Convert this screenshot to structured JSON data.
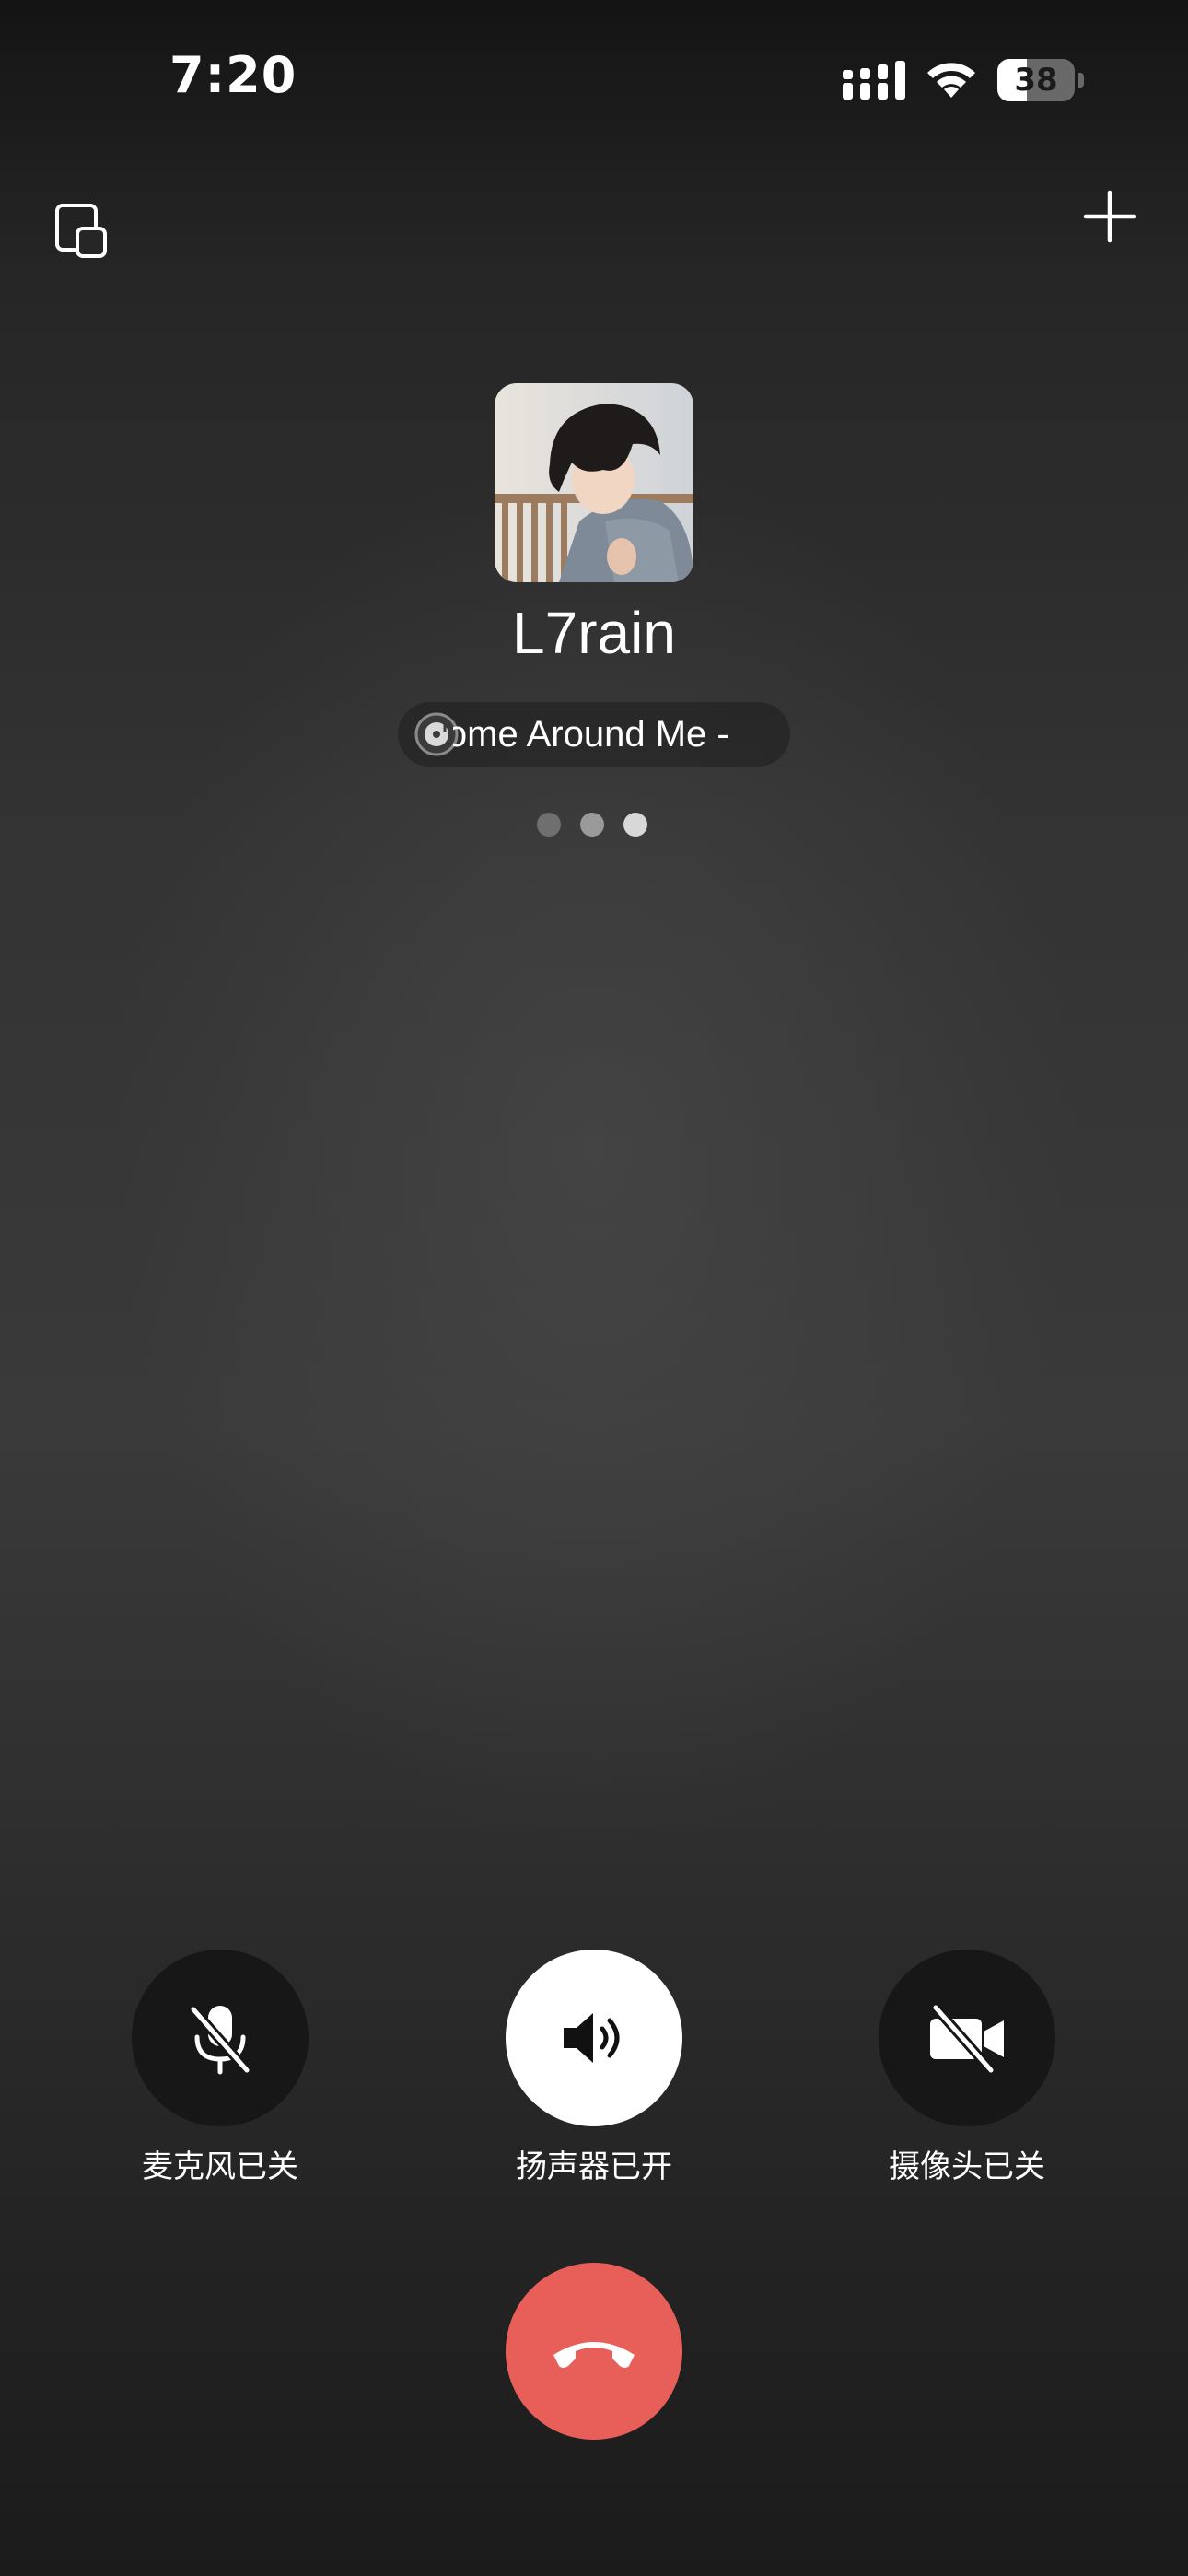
{
  "status_bar": {
    "time": "7:20",
    "battery_percent": 38,
    "battery_label": "38"
  },
  "top_actions": {
    "minimize_icon": "picture-in-picture-icon",
    "add_icon": "plus-icon"
  },
  "caller": {
    "name": "L7rain",
    "status_music": "Come Around Me - ",
    "avatar_description": "profile-photo"
  },
  "controls": {
    "mic_label": "麦克风已关",
    "speaker_label": "扬声器已开",
    "camera_label": "摄像头已关",
    "mic_icon": "mic-off-icon",
    "speaker_icon": "speaker-on-icon",
    "camera_icon": "camera-off-icon",
    "hangup_icon": "hang-up-icon"
  },
  "colors": {
    "hangup": "#e85f5a",
    "control_dark": "#171717",
    "control_light": "#ffffff",
    "dot_dim": "#6f6f6f",
    "dot_mid": "#9a9a9a",
    "dot_bright": "#d8d8d8"
  }
}
